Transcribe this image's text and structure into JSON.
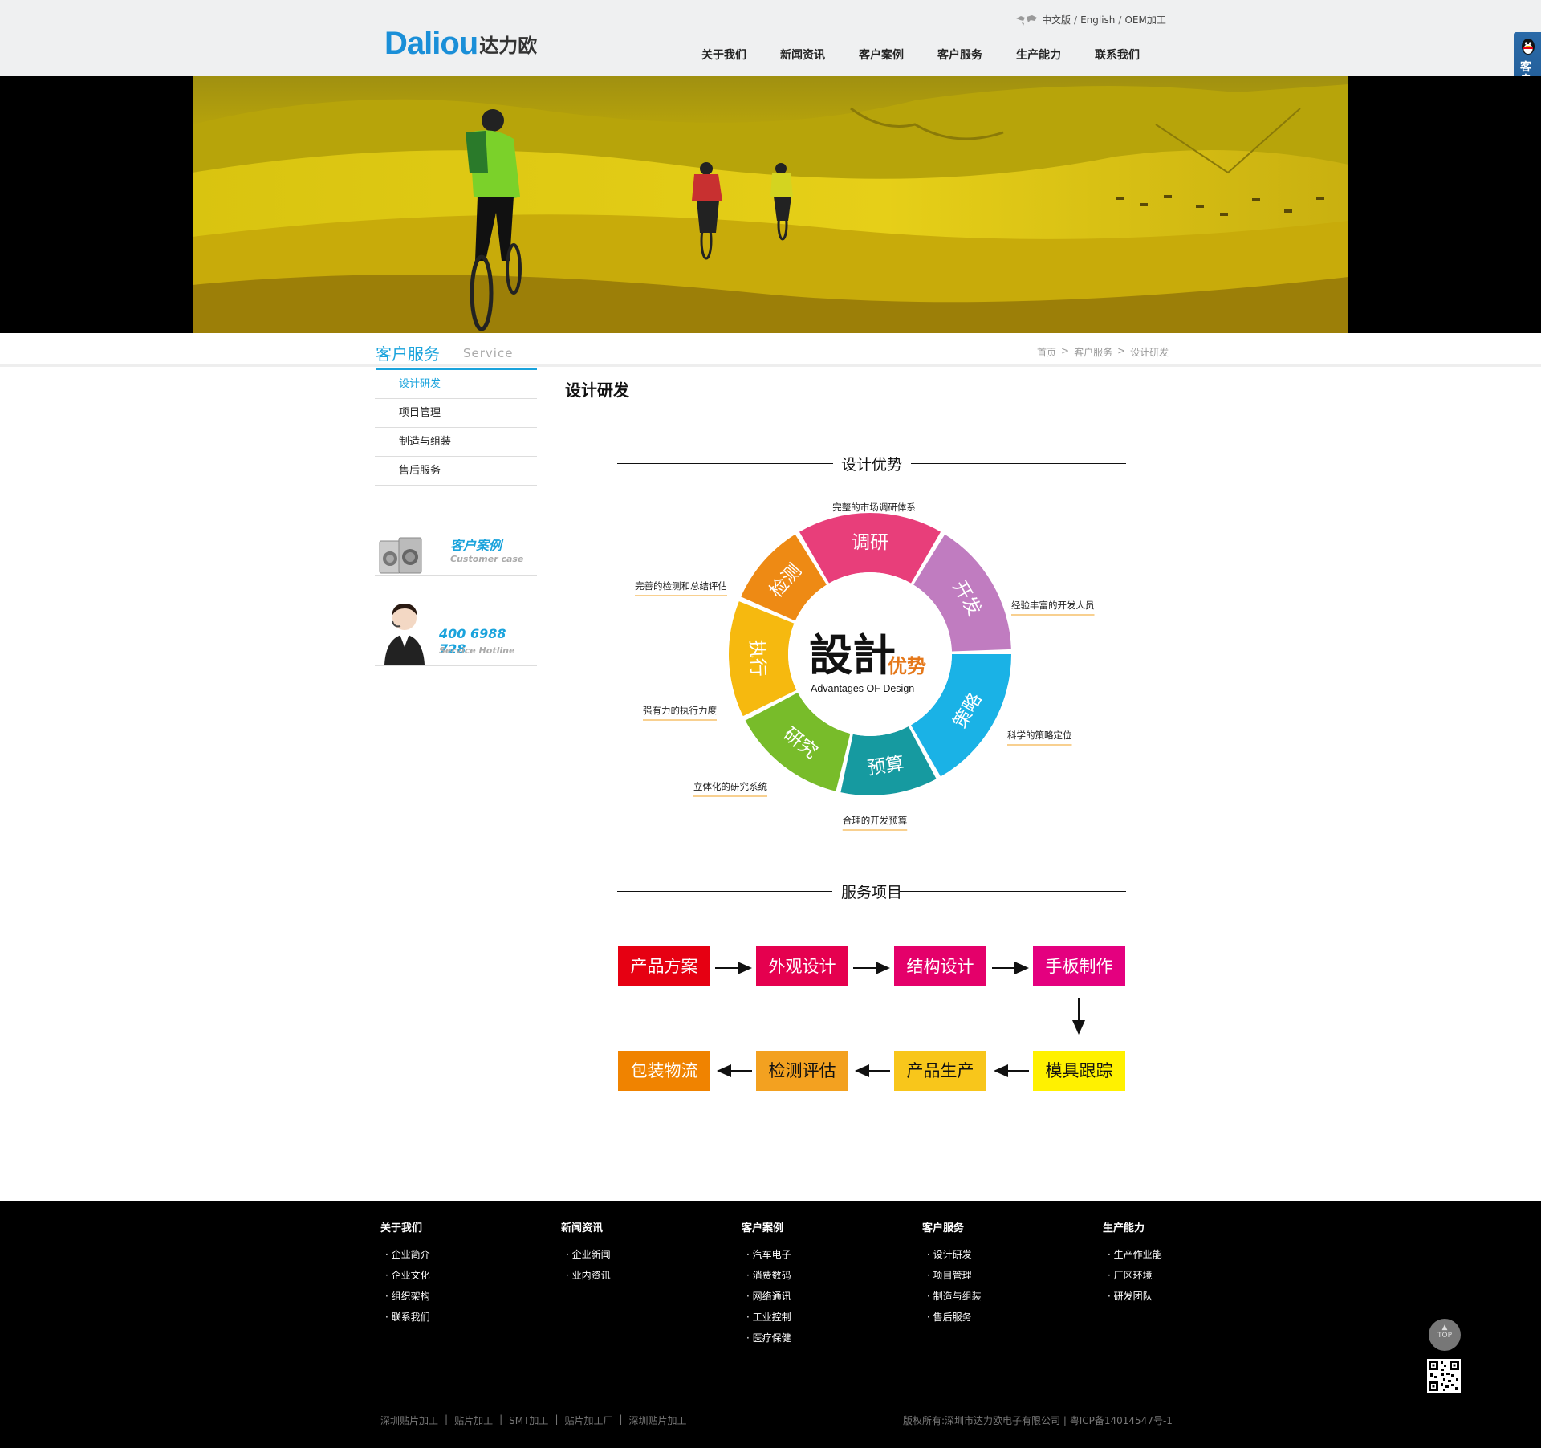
{
  "header": {
    "logo_en": "Daliou",
    "logo_cn": "达力欧",
    "lang": [
      "中文版",
      "English",
      "OEM加工"
    ],
    "lang_sep": "/",
    "nav": [
      "关于我们",
      "新闻资讯",
      "客户案例",
      "客户服务",
      "生产能力",
      "联系我们"
    ]
  },
  "side_tab": {
    "text": "客户服务中心",
    "icon": "qq-penguin-icon"
  },
  "section": {
    "title_cn": "客户服务",
    "title_en": "Service"
  },
  "breadcrumb": [
    "首页",
    "客户服务",
    "设计研发"
  ],
  "breadcrumb_sep": ">",
  "side_menu": [
    "设计研发",
    "项目管理",
    "制造与组装",
    "售后服务"
  ],
  "promos": {
    "case_cn": "客户案例",
    "case_en": "Customer case",
    "hotline": "400 6988 728",
    "hotline_en": "Service Hotline"
  },
  "page_title": "设计研发",
  "design": {
    "heading": "设计优势",
    "center_cn_a": "設計",
    "center_cn_b": "优势",
    "center_en": "Advantages OF Design",
    "segments": [
      {
        "label": "调研",
        "color": "#e83e7a"
      },
      {
        "label": "开发",
        "color": "#c07cc0"
      },
      {
        "label": "策略",
        "color": "#1ab2e6"
      },
      {
        "label": "预算",
        "color": "#169aa0"
      },
      {
        "label": "研究",
        "color": "#78bc2a"
      },
      {
        "label": "执行",
        "color": "#f6b90f"
      },
      {
        "label": "检测",
        "color": "#ee8a14"
      }
    ],
    "notes": [
      "完整的市场调研体系",
      "经验丰富的开发人员",
      "科学的策略定位",
      "合理的开发预算",
      "立体化的研究系统",
      "强有力的执行力度",
      "完善的检测和总结评估"
    ]
  },
  "service": {
    "heading": "服务项目",
    "row1": [
      {
        "label": "产品方案",
        "color": "#e60012"
      },
      {
        "label": "外观设计",
        "color": "#e5004f"
      },
      {
        "label": "结构设计",
        "color": "#e4006a"
      },
      {
        "label": "手板制作",
        "color": "#e4007f"
      }
    ],
    "row2": [
      {
        "label": "包装物流",
        "color": "#f08300"
      },
      {
        "label": "检测评估",
        "color": "#f3a120"
      },
      {
        "label": "产品生产",
        "color": "#f8c61b"
      },
      {
        "label": "模具跟踪",
        "color": "#fff100"
      }
    ]
  },
  "footer": {
    "cols": [
      {
        "title": "关于我们",
        "links": [
          "企业简介",
          "企业文化",
          "组织架构",
          "联系我们"
        ]
      },
      {
        "title": "新闻资讯",
        "links": [
          "企业新闻",
          "业内资讯"
        ]
      },
      {
        "title": "客户案例",
        "links": [
          "汽车电子",
          "消费数码",
          "网络通讯",
          "工业控制",
          "医疗保健"
        ]
      },
      {
        "title": "客户服务",
        "links": [
          "设计研发",
          "项目管理",
          "制造与组装",
          "售后服务"
        ]
      },
      {
        "title": "生产能力",
        "links": [
          "生产作业能",
          "厂区环境",
          "研发团队"
        ]
      }
    ],
    "seo_links": [
      "深圳贴片加工",
      "贴片加工",
      "SMT加工",
      "贴片加工厂",
      "深圳贴片加工"
    ],
    "seo_sep": "|",
    "copyright": "版权所有:深圳市达力欧电子有限公司 | 粤ICP备14014547号-1",
    "top": "TOP"
  }
}
